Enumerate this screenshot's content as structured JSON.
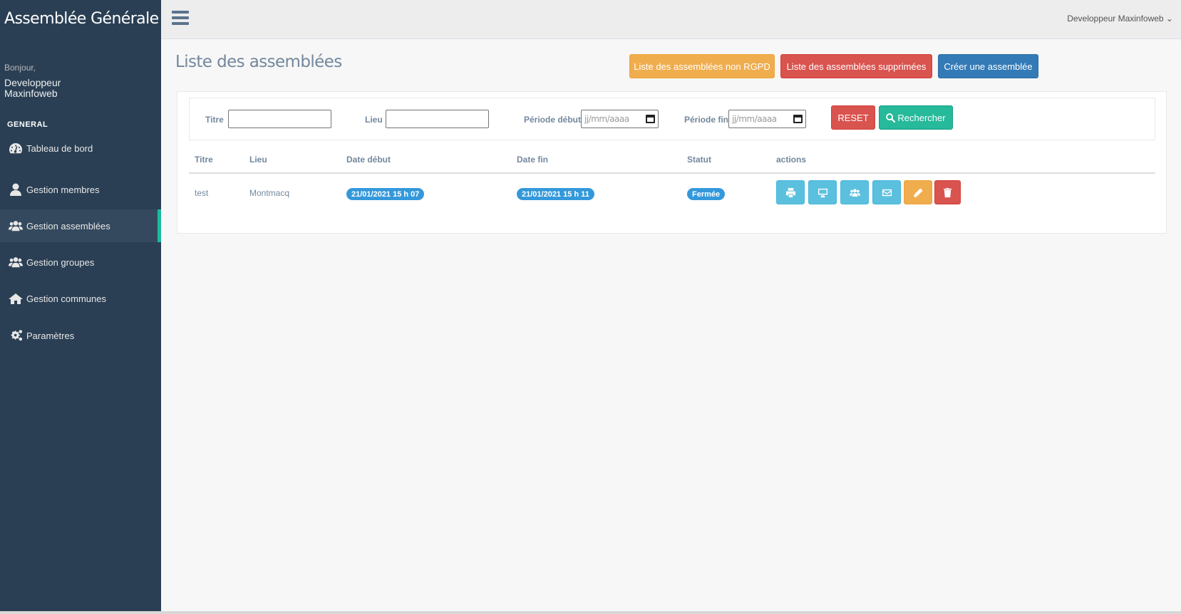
{
  "app": {
    "title": "Assemblée Générale"
  },
  "sidebar": {
    "greeting": "Bonjour,",
    "user_name": "Developpeur Maxinfoweb",
    "section_title": "GENERAL",
    "items": [
      {
        "label": "Tableau de bord",
        "icon": "dashboard-icon",
        "active": false
      },
      {
        "label": "Gestion membres",
        "icon": "user-icon",
        "active": false
      },
      {
        "label": "Gestion assemblées",
        "icon": "users-icon",
        "active": true
      },
      {
        "label": "Gestion groupes",
        "icon": "group-icon",
        "active": false
      },
      {
        "label": "Gestion communes",
        "icon": "home-icon",
        "active": false
      },
      {
        "label": "Paramètres",
        "icon": "gears-icon",
        "active": false
      }
    ]
  },
  "topbar": {
    "user_menu": "Developpeur Maxinfoweb ⌄"
  },
  "page": {
    "title": "Liste des assemblées",
    "buttons": {
      "non_rgpd": "Liste des assemblées non RGPD",
      "deleted": "Liste des assemblées supprimées",
      "create": "Créer une assemblée"
    }
  },
  "filters": {
    "titre_label": "Titre",
    "lieu_label": "Lieu",
    "debut_label": "Période début",
    "fin_label": "Période fin",
    "date_placeholder": "jj/mm/aaaa",
    "reset": "RESET",
    "search": "Rechercher"
  },
  "table": {
    "headers": [
      "Titre",
      "Lieu",
      "Date début",
      "Date fin",
      "Statut",
      "actions"
    ],
    "rows": [
      {
        "titre": "test",
        "lieu": "Montmacq",
        "date_debut": "21/01/2021 15 h 07",
        "date_fin": "21/01/2021 15 h 11",
        "statut": "Fermée"
      }
    ],
    "action_icons": [
      "print-icon",
      "desktop-icon",
      "users-icon",
      "envelope-icon",
      "pencil-icon",
      "trash-icon"
    ]
  },
  "colors": {
    "sidebar_bg": "#2a3f54",
    "accent": "#1abb9c",
    "warning": "#f0ad4e",
    "danger": "#d9534f",
    "primary": "#337ab7",
    "success": "#26b99a",
    "info": "#5bc0de",
    "badge": "#3498db"
  }
}
